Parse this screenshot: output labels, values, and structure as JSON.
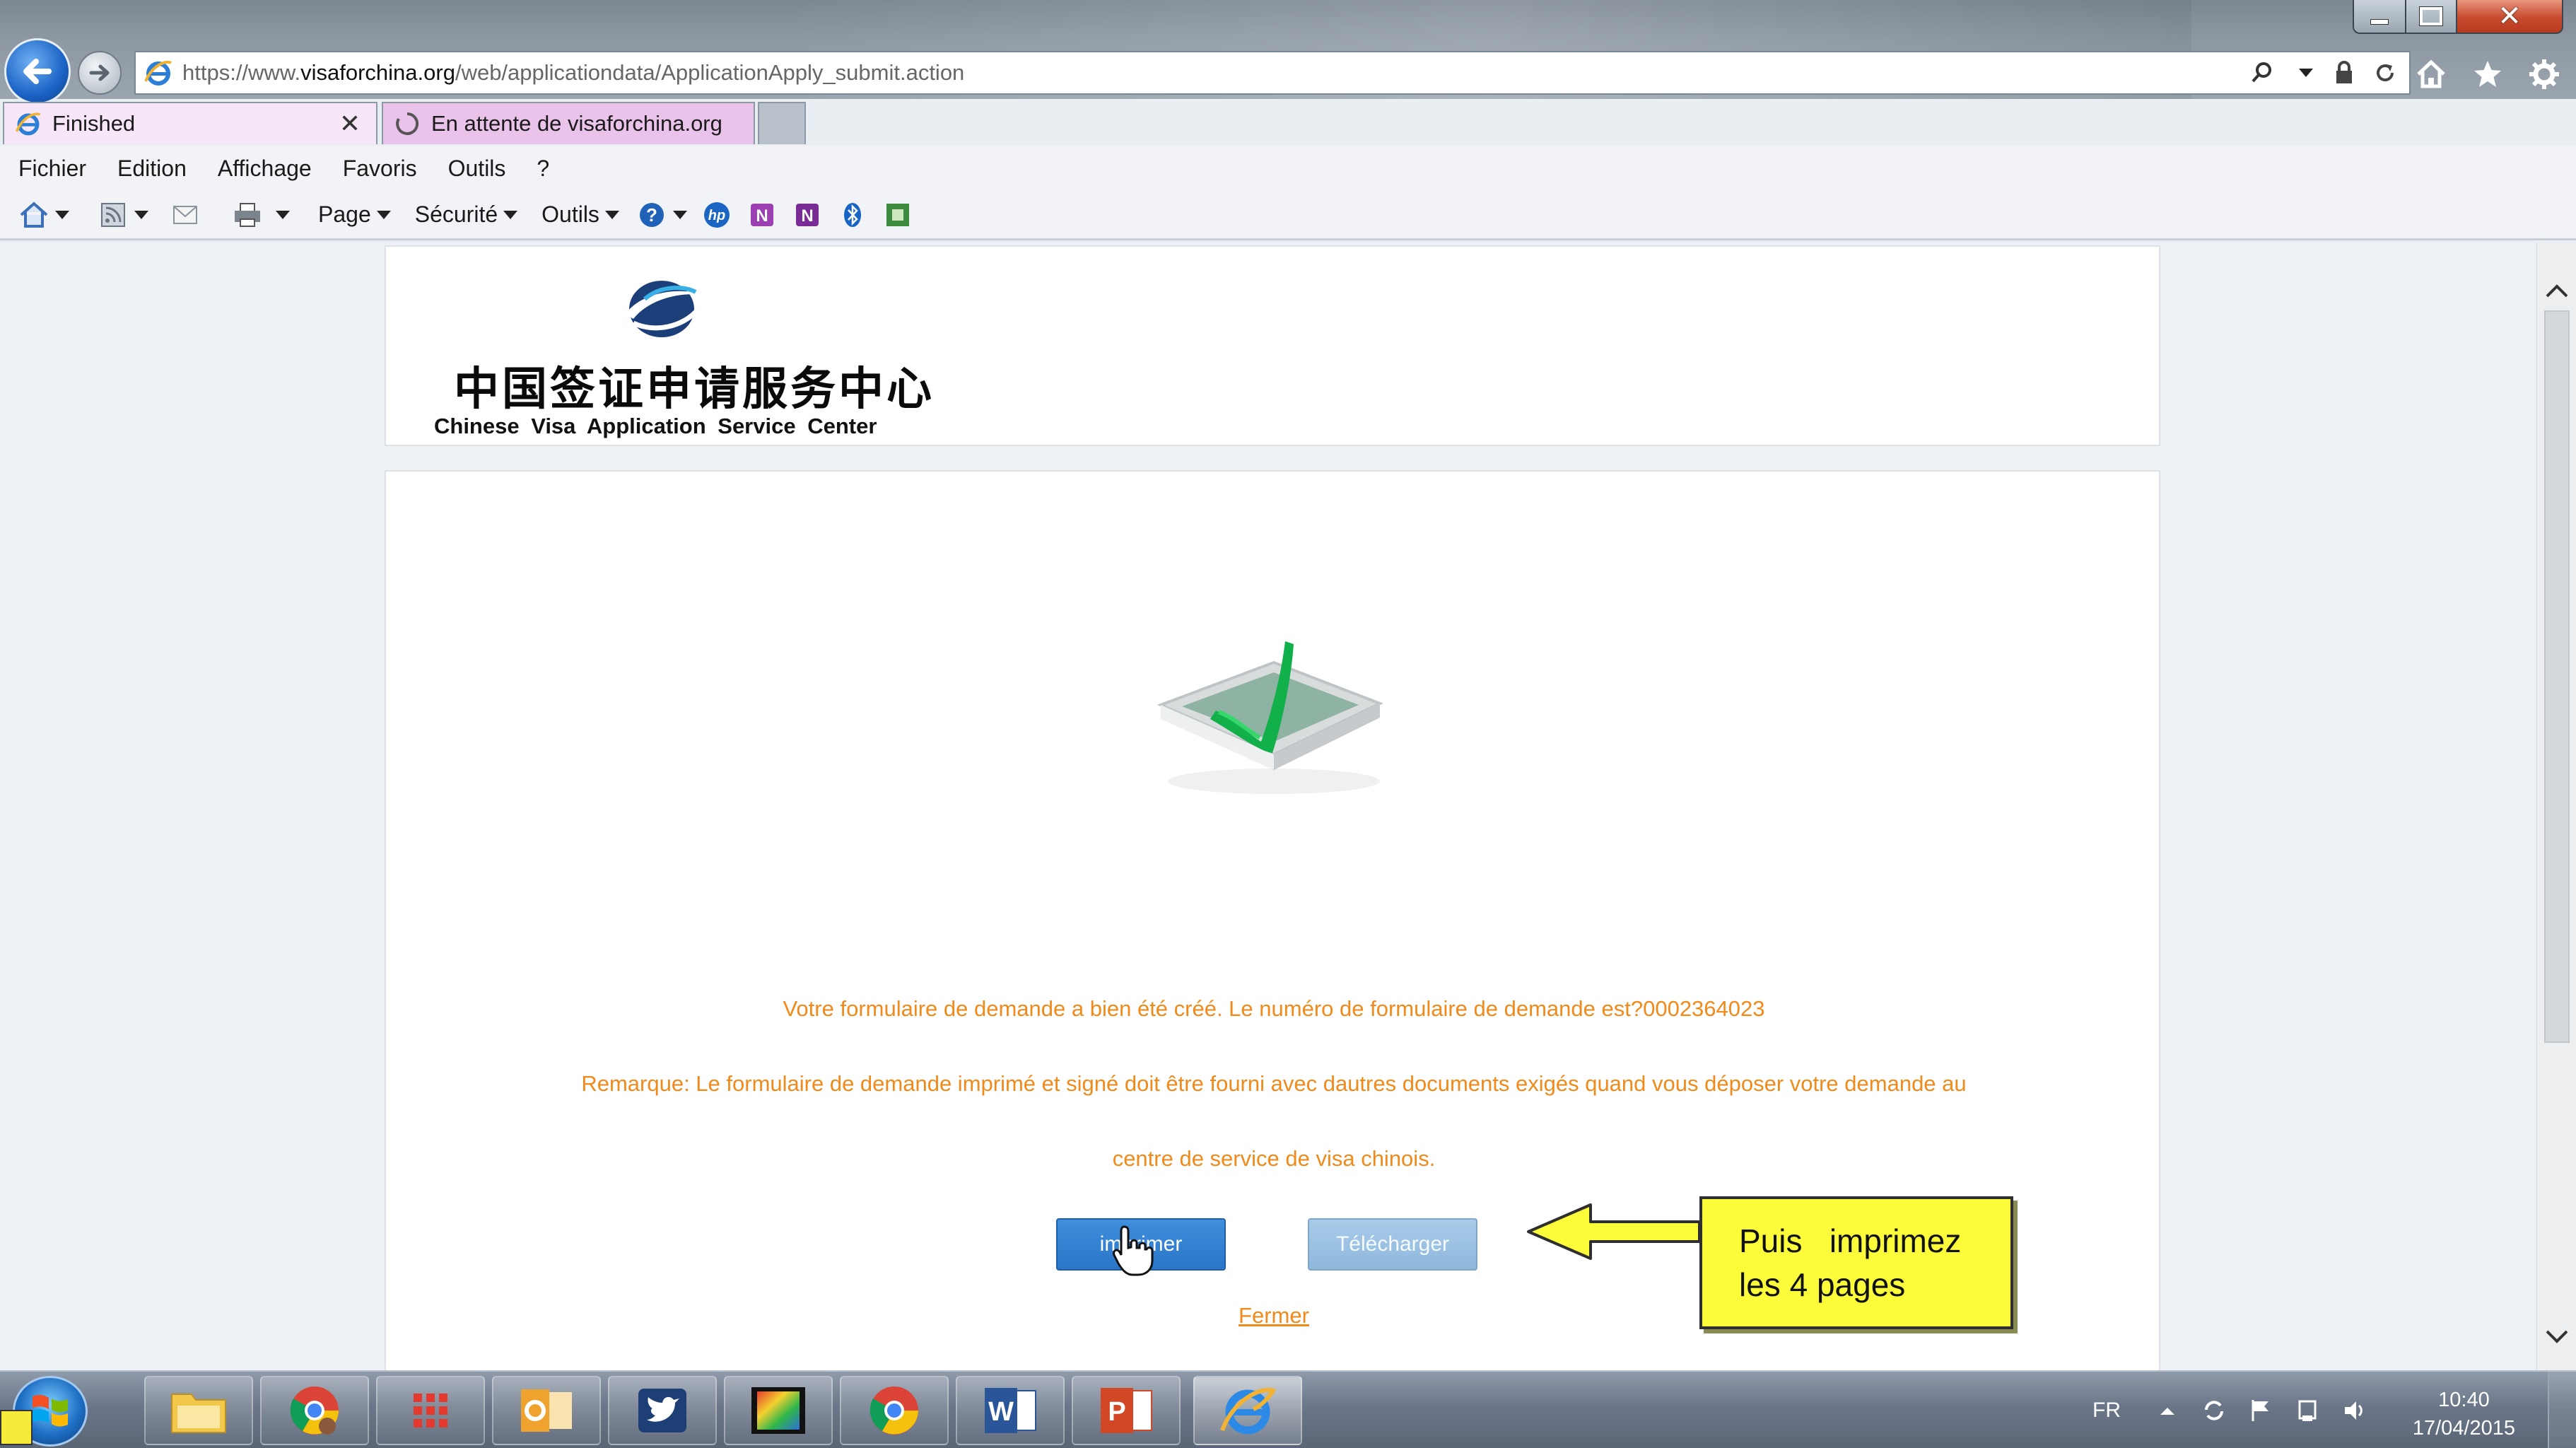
{
  "browser": {
    "url_prefix": "https://www.",
    "url_domain": "visaforchina.org",
    "url_path": "/web/applicationdata/ApplicationApply_submit.action",
    "tabs": [
      {
        "label": "Finished",
        "icon": "ie-page-icon",
        "active": true
      },
      {
        "label": "En attente de visaforchina.org",
        "icon": "loading-spinner-icon",
        "active": false
      }
    ],
    "menu": [
      "Fichier",
      "Edition",
      "Affichage",
      "Favoris",
      "Outils",
      "?"
    ],
    "command_bar": {
      "page": "Page",
      "security": "Sécurité",
      "tools": "Outils"
    }
  },
  "site": {
    "logo_cn": "中国签证申请服务中心",
    "logo_en": "Chinese  Visa  Application  Service  Center"
  },
  "confirmation": {
    "message": "Votre formulaire de demande a bien été créé. Le numéro de formulaire de demande est?0002364023",
    "remark_line1": "Remarque: Le formulaire de demande imprimé et signé doit être fourni avec dautres documents exigés quand vous déposer votre demande au",
    "remark_line2": "centre de service de visa chinois.",
    "print_button": "imprimer",
    "download_button": "Télécharger",
    "close_link": "Fermer",
    "text_color": "#f08a1a"
  },
  "annotation": {
    "line1": "Puis   imprimez",
    "line2": "les 4 pages"
  },
  "taskbar": {
    "apps": [
      "explorer",
      "chrome-user",
      "apps-grid",
      "outlook",
      "twitter",
      "media",
      "chrome",
      "word",
      "powerpoint",
      "internet-explorer"
    ],
    "language": "FR",
    "time": "10:40",
    "date": "17/04/2015"
  }
}
